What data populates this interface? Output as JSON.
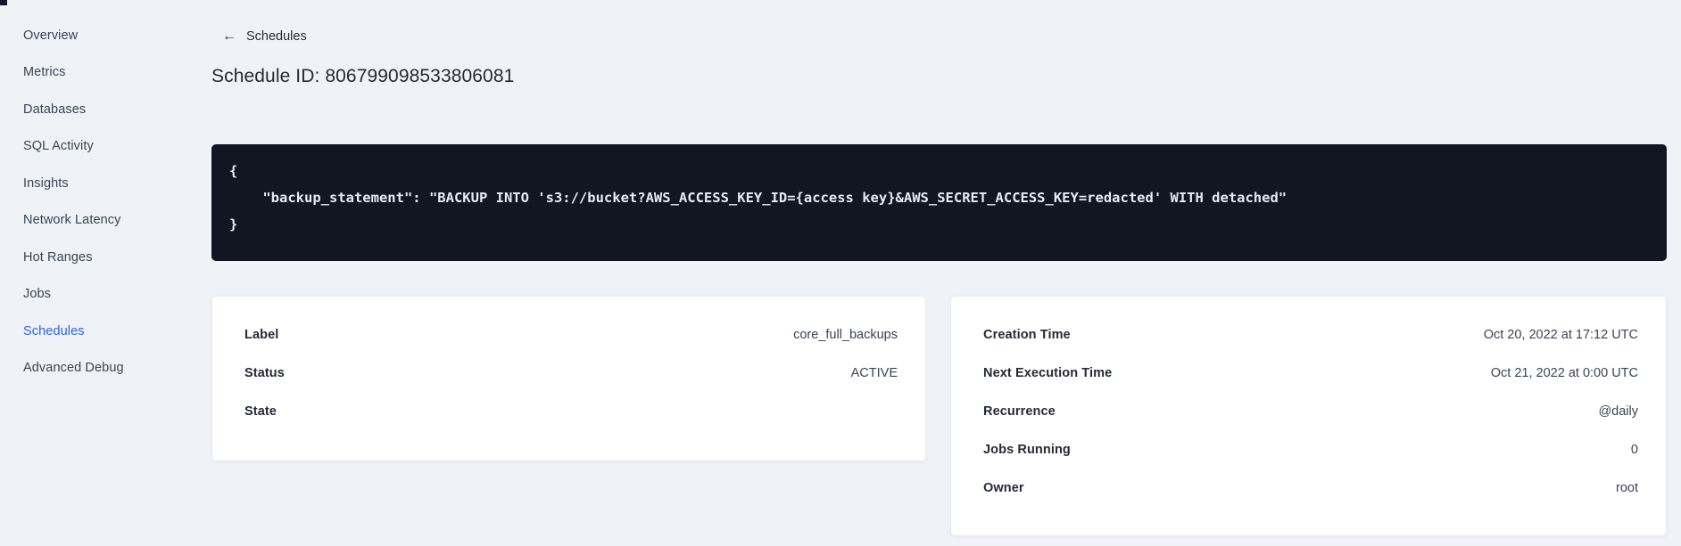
{
  "sidebar": {
    "items": [
      {
        "label": "Overview"
      },
      {
        "label": "Metrics"
      },
      {
        "label": "Databases"
      },
      {
        "label": "SQL Activity"
      },
      {
        "label": "Insights"
      },
      {
        "label": "Network Latency"
      },
      {
        "label": "Hot Ranges"
      },
      {
        "label": "Jobs"
      },
      {
        "label": "Schedules",
        "active": true
      },
      {
        "label": "Advanced Debug"
      }
    ],
    "active_color": "#2c64d9"
  },
  "header": {
    "back_label": "Schedules",
    "title": "Schedule ID: 806799098533806081"
  },
  "icons": {
    "back_arrow": "←"
  },
  "code_block": {
    "bg_color": "#111622",
    "lines": [
      "{",
      "    \"backup_statement\": \"BACKUP INTO 's3://bucket?AWS_ACCESS_KEY_ID={access key}&AWS_SECRET_ACCESS_KEY=redacted' WITH detached\"",
      "}"
    ]
  },
  "left_card": {
    "rows": [
      {
        "label": "Label",
        "value": "core_full_backups"
      },
      {
        "label": "Status",
        "value": "ACTIVE"
      },
      {
        "label": "State",
        "value": ""
      }
    ]
  },
  "right_card": {
    "rows": [
      {
        "label": "Creation Time",
        "value": "Oct 20, 2022 at 17:12 UTC"
      },
      {
        "label": "Next Execution Time",
        "value": "Oct 21, 2022 at 0:00 UTC"
      },
      {
        "label": "Recurrence",
        "value": "@daily"
      },
      {
        "label": "Jobs Running",
        "value": "0"
      },
      {
        "label": "Owner",
        "value": "root"
      }
    ]
  },
  "colors": {
    "page_bg": "#eff3f7",
    "text_primary": "#242a35",
    "card_bg": "#ffffff"
  }
}
